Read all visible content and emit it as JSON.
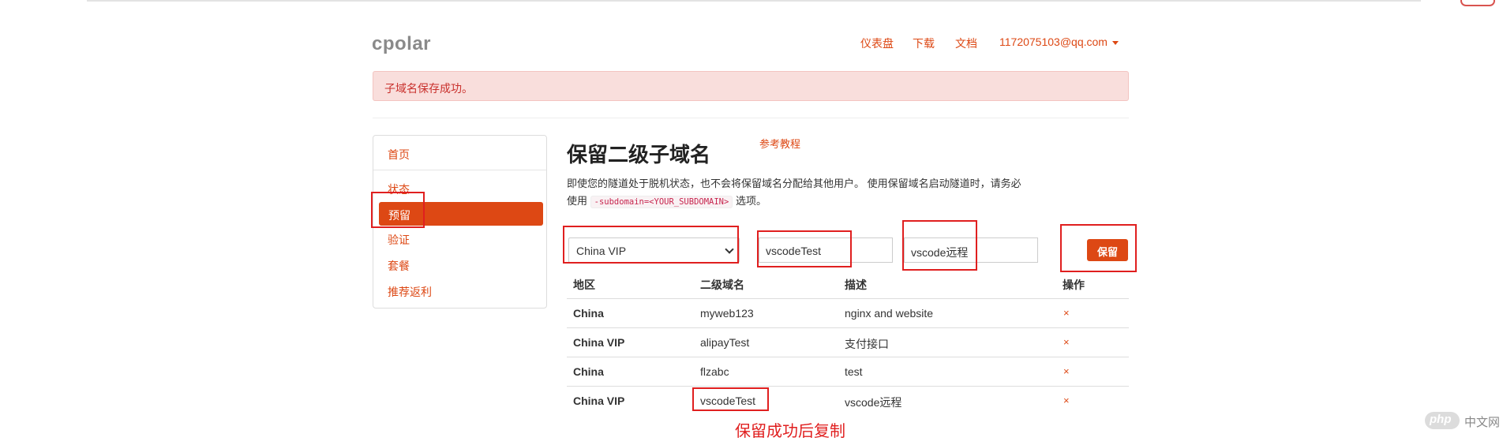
{
  "brand": "cpolar",
  "nav": {
    "dashboard": "仪表盘",
    "download": "下载",
    "docs": "文档",
    "account": "1172075103@qq.com"
  },
  "alert": {
    "message": "子域名保存成功。"
  },
  "sidebar": {
    "items": [
      "首页",
      "状态",
      "预留",
      "验证",
      "套餐",
      "推荐返利"
    ],
    "active_index": 2
  },
  "main": {
    "title": "保留二级子域名",
    "ref_link": "参考教程",
    "desc_before": "即使您的隧道处于脱机状态，也不会将保留域名分配给其他用户。 使用保留域名启动隧道时，请务必使用",
    "desc_code": "-subdomain=<YOUR_SUBDOMAIN>",
    "desc_after": "选项。"
  },
  "form": {
    "region_value": "China VIP",
    "subdomain_value": "vscodeTest",
    "description_value": "vscode远程",
    "save_label": "保留"
  },
  "table": {
    "headers": [
      "地区",
      "二级域名",
      "描述",
      "操作"
    ],
    "rows": [
      {
        "region": "China",
        "subdomain": "myweb123",
        "description": "nginx and website",
        "action": "×"
      },
      {
        "region": "China VIP",
        "subdomain": "alipayTest",
        "description": "支付接口",
        "action": "×"
      },
      {
        "region": "China",
        "subdomain": "flzabc",
        "description": "test",
        "action": "×"
      },
      {
        "region": "China VIP",
        "subdomain": "vscodeTest",
        "description": "vscode远程",
        "action": "×"
      }
    ]
  },
  "annotation": "保留成功后复制",
  "watermark": {
    "logo": "php",
    "text": "中文网"
  },
  "colors": {
    "accent": "#dd4814",
    "annotation_red": "#e01f1f",
    "alert_bg": "#f9dedc"
  }
}
